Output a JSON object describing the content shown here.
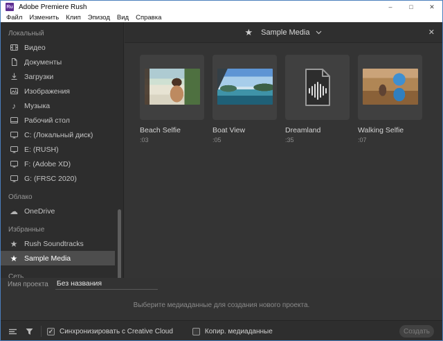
{
  "window": {
    "title": "Adobe Premiere Rush",
    "app_badge": "Ru",
    "controls": {
      "minimize": "–",
      "maximize": "□",
      "close": "✕"
    }
  },
  "menu": {
    "items": [
      "Файл",
      "Изменить",
      "Клип",
      "Эпизод",
      "Вид",
      "Справка"
    ]
  },
  "sidebar": {
    "sections": [
      {
        "label": "Локальный",
        "items": [
          {
            "icon": "film-icon",
            "label": "Видео"
          },
          {
            "icon": "document-icon",
            "label": "Документы"
          },
          {
            "icon": "download-icon",
            "label": "Загрузки"
          },
          {
            "icon": "image-icon",
            "label": "Изображения"
          },
          {
            "icon": "music-icon",
            "label": "Музыка"
          },
          {
            "icon": "desktop-icon",
            "label": "Рабочий стол"
          },
          {
            "icon": "drive-icon",
            "label": "C: (Локальный диск)"
          },
          {
            "icon": "drive-icon",
            "label": "E: (RUSH)"
          },
          {
            "icon": "drive-icon",
            "label": "F: (Adobe XD)"
          },
          {
            "icon": "drive-icon",
            "label": "G: (FRSC 2020)"
          }
        ]
      },
      {
        "label": "Облако",
        "items": [
          {
            "icon": "cloud-icon",
            "label": "OneDrive"
          }
        ]
      },
      {
        "label": "Избранные",
        "items": [
          {
            "icon": "star-icon",
            "label": "Rush Soundtracks",
            "selected": false
          },
          {
            "icon": "star-icon",
            "label": "Sample Media",
            "selected": true
          }
        ]
      },
      {
        "label": "Сеть",
        "items": []
      }
    ]
  },
  "media_panel": {
    "title": "Sample Media",
    "close_icon": "✕",
    "items": [
      {
        "name": "Beach Selfie",
        "duration": ":03",
        "type": "video"
      },
      {
        "name": "Boat View",
        "duration": ":05",
        "type": "video"
      },
      {
        "name": "Dreamland",
        "duration": ":35",
        "type": "audio"
      },
      {
        "name": "Walking Selfie",
        "duration": ":07",
        "type": "video"
      }
    ]
  },
  "project": {
    "name_label": "Имя проекта",
    "name_value": "Без названия"
  },
  "footer": {
    "message": "Выберите медиаданные для создания нового проекта.",
    "sync_cc": {
      "label": "Синхронизировать с Creative Cloud",
      "checked": true
    },
    "copy_media": {
      "label": "Копир. медиаданные",
      "checked": false
    },
    "create_label": "Создать"
  },
  "colors": {
    "accent_purple": "#5d2f91",
    "titlebar_bg": "#ffffff",
    "sidebar_bg": "#2d2d2d",
    "main_bg": "#343434",
    "card_bg": "#404040",
    "selected_row_bg": "#4d4d4d",
    "window_border": "#4a7ebc"
  }
}
